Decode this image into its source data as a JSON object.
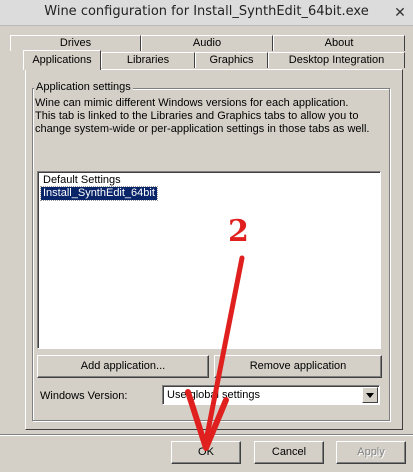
{
  "window": {
    "title": "Wine configuration for Install_SynthEdit_64bit.exe",
    "close_glyph": "✕"
  },
  "tabs_row1": [
    {
      "label": "Drives"
    },
    {
      "label": "Audio"
    },
    {
      "label": "About"
    }
  ],
  "tabs_row2": [
    {
      "label": "Applications",
      "active": true
    },
    {
      "label": "Libraries"
    },
    {
      "label": "Graphics"
    },
    {
      "label": "Desktop Integration"
    }
  ],
  "app_settings": {
    "group_title": "Application settings",
    "description": "Wine can mimic different Windows versions for each application. This tab is linked to the Libraries and Graphics tabs to allow you to change system-wide or per-application settings in those tabs as well.",
    "list_items": [
      {
        "label": "Default Settings",
        "selected": false
      },
      {
        "label": "Install_SynthEdit_64bit",
        "selected": true
      }
    ],
    "add_button": "Add application...",
    "remove_button": "Remove application",
    "windows_version_label": "Windows Version:",
    "windows_version_value": "Use global settings"
  },
  "footer": {
    "ok": "OK",
    "cancel": "Cancel",
    "apply": "Apply"
  },
  "annotation": {
    "number": "2",
    "color": "#e0201e"
  }
}
